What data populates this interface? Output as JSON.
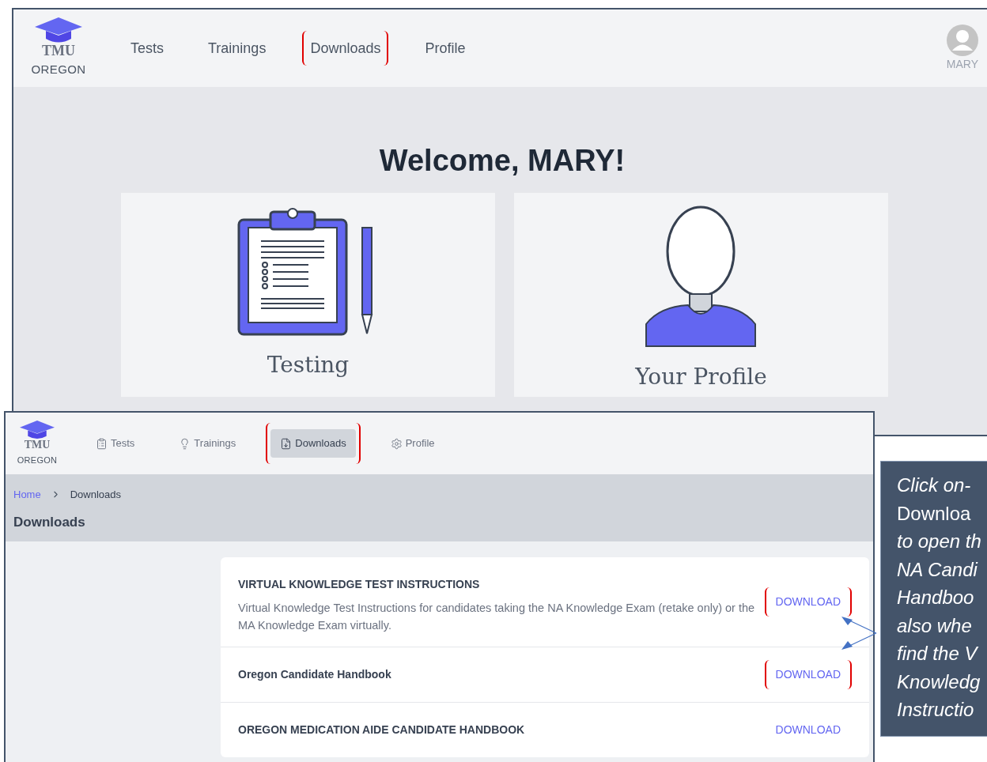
{
  "back_screen": {
    "logo": {
      "name": "TMU",
      "sub": "OREGON"
    },
    "nav": [
      {
        "label": "Tests",
        "highlighted": false
      },
      {
        "label": "Trainings",
        "highlighted": false
      },
      {
        "label": "Downloads",
        "highlighted": true
      },
      {
        "label": "Profile",
        "highlighted": false
      }
    ],
    "user": "MARY",
    "welcome": "Welcome, MARY!",
    "cards": [
      {
        "kind": "testing",
        "label": "Testing"
      },
      {
        "kind": "profile",
        "label": "Your Profile"
      }
    ]
  },
  "front_screen": {
    "logo": {
      "name": "TMU",
      "sub": "OREGON"
    },
    "nav": [
      {
        "kind": "tests",
        "label": "Tests",
        "selected": false,
        "highlighted": false
      },
      {
        "kind": "trainings",
        "label": "Trainings",
        "selected": false,
        "highlighted": false
      },
      {
        "kind": "downloads",
        "label": "Downloads",
        "selected": true,
        "highlighted": true
      },
      {
        "kind": "profile",
        "label": "Profile",
        "selected": false,
        "highlighted": false
      }
    ],
    "breadcrumb": [
      {
        "label": "Home",
        "link": true
      },
      {
        "label": "Downloads",
        "link": false
      }
    ],
    "page_title": "Downloads",
    "downloads": [
      {
        "title": "VIRTUAL KNOWLEDGE TEST INSTRUCTIONS",
        "description": "Virtual Knowledge Test Instructions for candidates taking the NA Knowledge Exam (retake only) or the MA Knowledge Exam virtually.",
        "action": "DOWNLOAD",
        "highlighted": true
      },
      {
        "title": "Oregon Candidate Handbook",
        "action": "DOWNLOAD",
        "highlighted": true
      },
      {
        "title": "OREGON MEDICATION AIDE CANDIDATE HANDBOOK",
        "action": "DOWNLOAD",
        "highlighted": false
      }
    ]
  },
  "callout": {
    "lines": [
      {
        "text": "Click on-",
        "kind": "italic"
      },
      {
        "text": "Downloa",
        "kind": "bold"
      },
      {
        "text": "to open th",
        "kind": "italic"
      },
      {
        "text": "NA Candi",
        "kind": "italic"
      },
      {
        "text": "Handboo",
        "kind": "italic"
      },
      {
        "text": "also whe",
        "kind": "italic"
      },
      {
        "text": "find the V",
        "kind": "italic"
      },
      {
        "text": "Knowledg",
        "kind": "italic"
      },
      {
        "text": "Instructio",
        "kind": "italic"
      }
    ]
  }
}
